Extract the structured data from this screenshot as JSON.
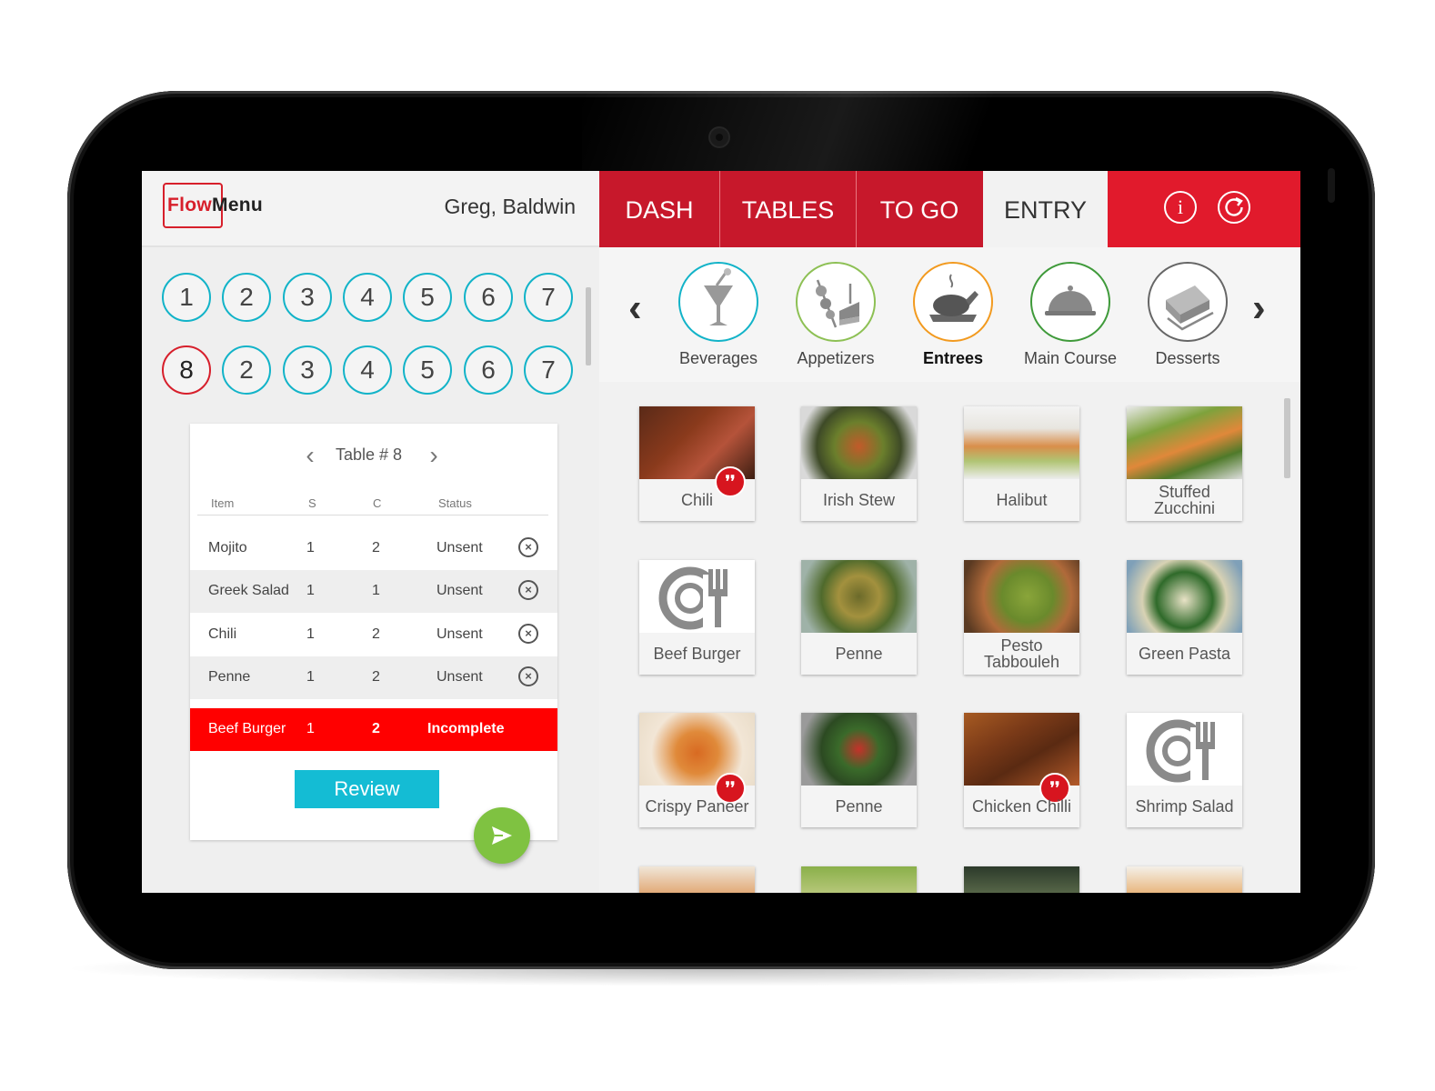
{
  "app": {
    "logo_flow": "Flow",
    "logo_menu": "Menu",
    "user_name": "Greg, Baldwin"
  },
  "seats": {
    "row1": [
      "1",
      "2",
      "3",
      "4",
      "5",
      "6",
      "7"
    ],
    "row2": [
      "8",
      "2",
      "3",
      "4",
      "5",
      "6",
      "7"
    ],
    "selected": "8"
  },
  "order": {
    "title": "Table # 8",
    "headers": {
      "item": "Item",
      "s": "S",
      "c": "C",
      "status": "Status"
    },
    "rows": [
      {
        "item": "Mojito",
        "s": "1",
        "c": "2",
        "status": "Unsent"
      },
      {
        "item": "Greek Salad",
        "s": "1",
        "c": "1",
        "status": "Unsent"
      },
      {
        "item": "Chili",
        "s": "1",
        "c": "2",
        "status": "Unsent"
      },
      {
        "item": "Penne",
        "s": "1",
        "c": "2",
        "status": "Unsent"
      },
      {
        "item": "Beef Burger",
        "s": "1",
        "c": "2",
        "status": "Incomplete"
      }
    ],
    "review_label": "Review"
  },
  "nav": {
    "tabs": [
      "DASH",
      "TABLES",
      "TO GO",
      "ENTRY"
    ],
    "active": "ENTRY",
    "info_icon": "info-icon",
    "refresh_icon": "refresh-icon"
  },
  "categories": [
    {
      "label": "Beverages",
      "icon": "cocktail-icon",
      "color": "#12b3c8"
    },
    {
      "label": "Appetizers",
      "icon": "skewer-icon",
      "color": "#8dc054"
    },
    {
      "label": "Entrees",
      "icon": "roast-chicken-icon",
      "color": "#f29a1f",
      "selected": true
    },
    {
      "label": "Main Course",
      "icon": "cloche-icon",
      "color": "#3f9a3a"
    },
    {
      "label": "Desserts",
      "icon": "cake-icon",
      "color": "#666666"
    }
  ],
  "menu_items": [
    {
      "name": "Chili",
      "spicy": true
    },
    {
      "name": "Irish Stew",
      "spicy": false
    },
    {
      "name": "Halibut",
      "spicy": false
    },
    {
      "name": "Stuffed Zucchini",
      "spicy": false
    },
    {
      "name": "Beef Burger",
      "spicy": false,
      "placeholder": true
    },
    {
      "name": "Penne",
      "spicy": false
    },
    {
      "name": "Pesto Tabbouleh",
      "spicy": false
    },
    {
      "name": "Green Pasta",
      "spicy": false
    },
    {
      "name": "Crispy Paneer",
      "spicy": true
    },
    {
      "name": "Penne",
      "spicy": false
    },
    {
      "name": "Chicken Chilli",
      "spicy": true
    },
    {
      "name": "Shrimp Salad",
      "spicy": false,
      "placeholder": true
    }
  ],
  "colors": {
    "brand_red": "#c7182b",
    "accent_cyan": "#12b3c8",
    "incomplete_red": "#ff0000",
    "send_green": "#7fc241"
  }
}
